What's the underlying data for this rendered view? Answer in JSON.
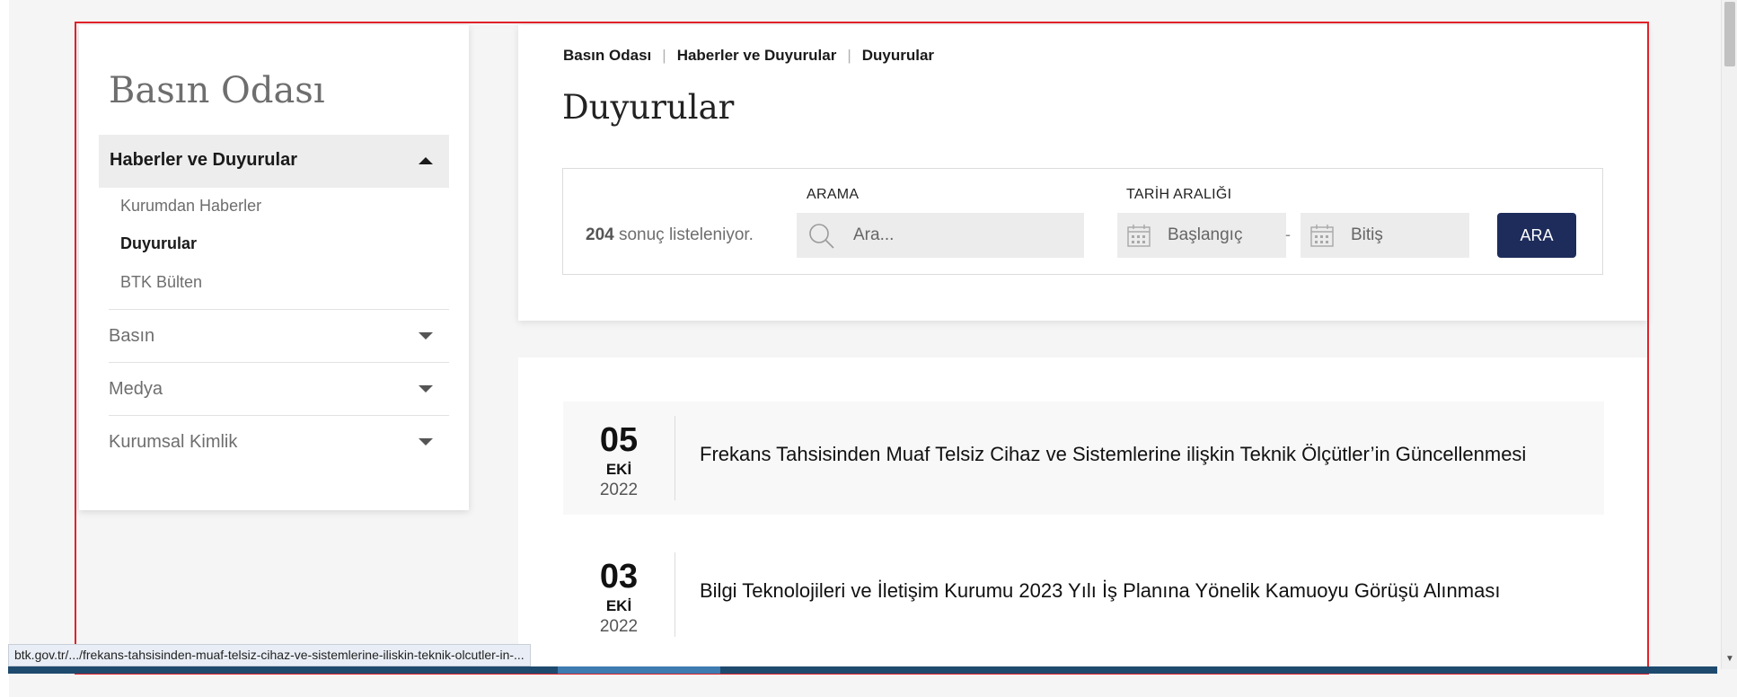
{
  "sidebar": {
    "title": "Basın Odası",
    "active_section": "Haberler ve Duyurular",
    "sub_items": [
      {
        "label": "Kurumdan Haberler",
        "active": false
      },
      {
        "label": "Duyurular",
        "active": true
      },
      {
        "label": "BTK Bülten",
        "active": false
      }
    ],
    "sections": [
      {
        "label": "Basın"
      },
      {
        "label": "Medya"
      },
      {
        "label": "Kurumsal Kimlik"
      }
    ]
  },
  "breadcrumb": [
    "Basın Odası",
    "Haberler ve Duyurular",
    "Duyurular"
  ],
  "page_title": "Duyurular",
  "search": {
    "result_count": "204",
    "result_suffix": "sonuç listeleniyor.",
    "search_label": "ARAMA",
    "search_placeholder": "Ara...",
    "date_label": "TARİH ARALIĞI",
    "start_placeholder": "Başlangıç",
    "end_placeholder": "Bitiş",
    "separator": "-",
    "button_label": "ARA"
  },
  "news": [
    {
      "day": "05",
      "month": "EKİ",
      "year": "2022",
      "title": "Frekans Tahsisinden Muaf Telsiz Cihaz ve Sistemlerine ilişkin Teknik Ölçütler’in Güncellenmesi"
    },
    {
      "day": "03",
      "month": "EKİ",
      "year": "2022",
      "title": "Bilgi Teknolojileri ve İletişim Kurumu 2023 Yılı İş Planına Yönelik Kamuoyu Görüşü Alınması"
    }
  ],
  "status_url": "btk.gov.tr/.../frekans-tahsisinden-muaf-telsiz-cihaz-ve-sistemlerine-iliskin-teknik-olcutler-in-...",
  "colors": {
    "accent": "#1d2c5b",
    "frame": "#e0222a"
  }
}
